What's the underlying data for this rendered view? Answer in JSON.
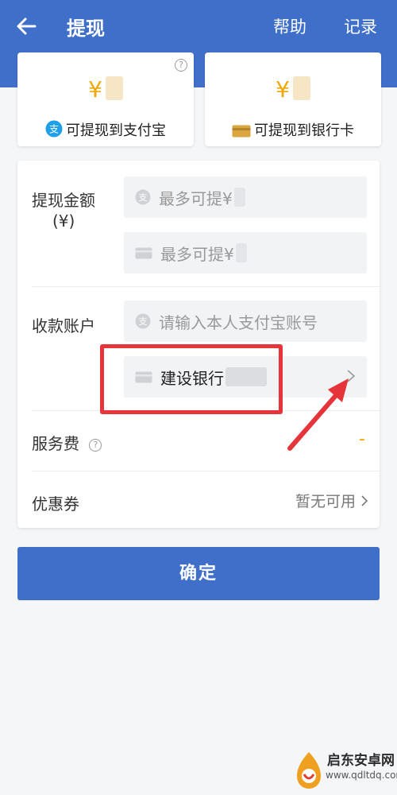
{
  "header": {
    "title": "提现",
    "help_label": "帮助",
    "records_label": "记录",
    "bg_color": "#3f6fc9"
  },
  "methods": [
    {
      "currency": "¥",
      "label": "可提现到支付宝",
      "icon": "alipay-icon"
    },
    {
      "currency": "¥",
      "label": "可提现到银行卡",
      "icon": "bank-card-icon"
    }
  ],
  "form": {
    "amount_label": "提现金额",
    "amount_unit": "(¥)",
    "alipay_max_placeholder": "最多可提¥",
    "bank_max_placeholder": "最多可提¥",
    "account_label": "收款账户",
    "alipay_account_placeholder": "请输入本人支付宝账号",
    "bank_selected": "建设银行",
    "fee_label": "服务费",
    "fee_value": "-",
    "coupon_label": "优惠券",
    "coupon_value": "暂无可用"
  },
  "confirm_label": "确定",
  "watermark": {
    "brand": "启东安卓网",
    "url": "www.qdltdq.com"
  },
  "colors": {
    "accent": "#3f6fc9",
    "yen": "#f0a800",
    "highlight": "#e5343a"
  }
}
